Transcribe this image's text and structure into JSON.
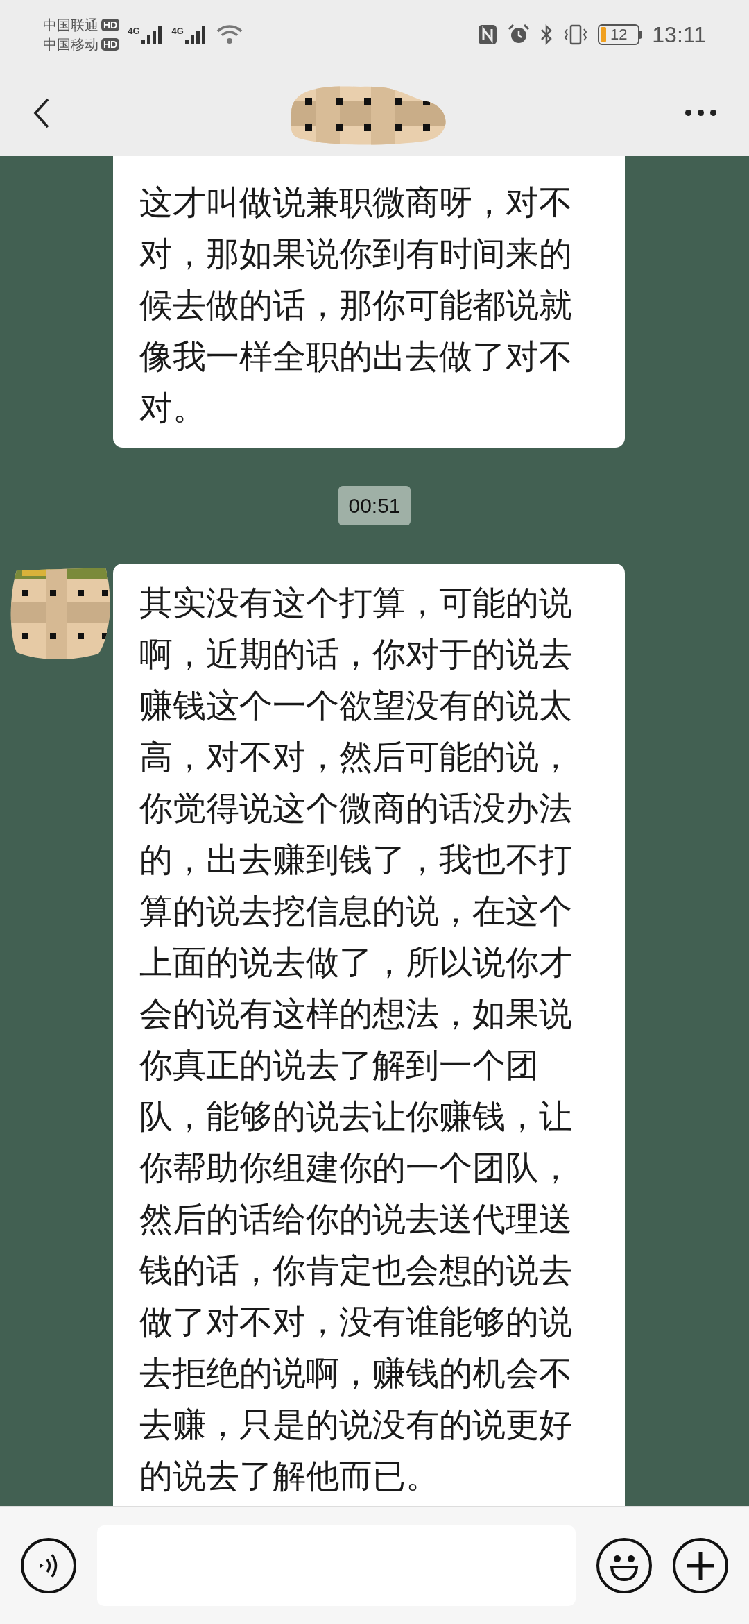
{
  "status_bar": {
    "carriers": [
      {
        "name": "中国联通",
        "badge": "HD"
      },
      {
        "name": "中国移动",
        "badge": "HD"
      }
    ],
    "network_labels": [
      "4G",
      "4G"
    ],
    "battery": "12",
    "time": "13:11"
  },
  "messages": [
    {
      "kind": "text",
      "show_avatar": false,
      "text": "这才叫做说兼职微商呀，对不对，那如果说你到有时间来的候去做的话，那你可能都说就像我一样全职的出去做了对不对。"
    },
    {
      "kind": "time",
      "text": "00:51"
    },
    {
      "kind": "text",
      "show_avatar": true,
      "text": "其实没有这个打算，可能的说啊，近期的话，你对于的说去赚钱这个一个欲望没有的说太高，对不对，然后可能的说，你觉得说这个微商的话没办法的，出去赚到钱了，我也不打算的说去挖信息的说，在这个上面的说去做了，所以说你才会的说有这样的想法，如果说你真正的说去了解到一个团队，能够的说去让你赚钱，让你帮助你组建你的一个团队，然后的话给你的说去送代理送钱的话，你肯定也会想的说去做了对不对，没有谁能够的说去拒绝的说啊，赚钱的机会不去赚，只是的说没有的说更好的说去了解他而已。"
    }
  ]
}
